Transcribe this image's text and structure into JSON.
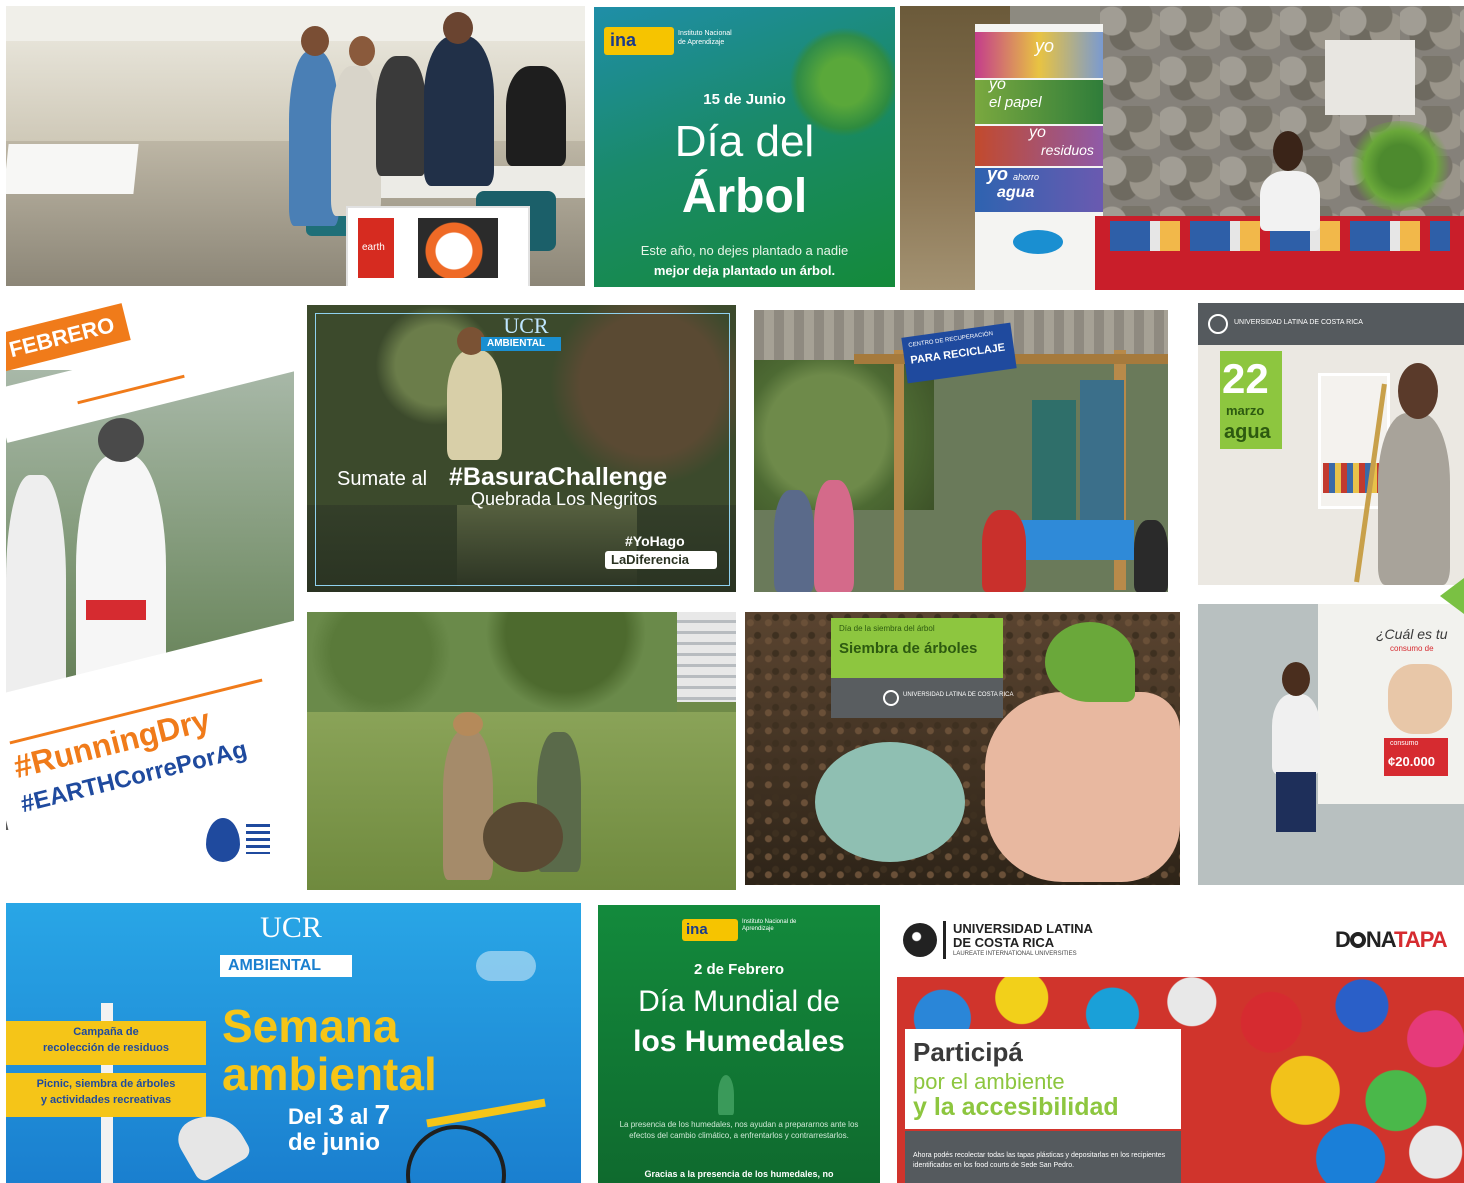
{
  "tiles": {
    "cafeteria": {
      "sign_brand": "earth"
    },
    "ina_arbol": {
      "logo": "ina",
      "logo_sub": "Instituto Nacional de Aprendizaje",
      "date": "15 de Junio",
      "title_line1": "Día del",
      "title_line2": "Árbol",
      "footer_line1": "Este año, no dejes plantado a nadie",
      "footer_line2": "mejor deja plantado un árbol."
    },
    "yo_banner": {
      "line1": "yo",
      "line2_prefix": "yo",
      "line2": "el papel",
      "line3_prefix": "yo",
      "line3": "residuos",
      "line4_prefix": "yo",
      "line4_small": "ahorro",
      "line4": "agua"
    },
    "running": {
      "month": "FEBRERO",
      "hashtag1": "#RunningDry",
      "hashtag2": "#EARTHCorrePorAg"
    },
    "basura": {
      "logo": "UCR",
      "logo_tag": "AMBIENTAL",
      "text_prefix": "Sumate al",
      "hashtag": "#BasuraChallenge",
      "subtitle": "Quebrada Los Negritos",
      "tag1": "#YoHago",
      "tag2": "LaDiferencia"
    },
    "reciclaje": {
      "sign": "PARA RECICLAJE",
      "sign_small": "CENTRO DE RECUPERACIÓN"
    },
    "agua": {
      "logo": "UNIVERSIDAD LATINA DE COSTA RICA",
      "day": "22",
      "month": "marzo",
      "word": "agua"
    },
    "siembra": {
      "small": "Día de la siembra del árbol",
      "title": "Siembra de árboles",
      "logo": "UNIVERSIDAD LATINA DE COSTA RICA"
    },
    "consumo": {
      "question": "¿Cuál es tu",
      "question2": "consumo de",
      "price_label": "consumo",
      "price": "¢20.000"
    },
    "semana": {
      "logo": "UCR",
      "logo_tag": "AMBIENTAL",
      "sign1_line1": "Campaña de",
      "sign1_line2": "recolección de residuos",
      "sign2_line1": "Picnic, siembra de árboles",
      "sign2_line2": "y actividades recreativas",
      "title1": "Semana",
      "title2": "ambiental",
      "dates_line1_a": "Del ",
      "dates_line1_b": "3",
      "dates_line1_c": " al ",
      "dates_line1_d": "7",
      "dates_line2": "de junio"
    },
    "humedales": {
      "logo": "ina",
      "logo_sub": "Instituto Nacional de Aprendizaje",
      "date": "2 de Febrero",
      "title_line1": "Día Mundial de",
      "title_line2": "los Humedales",
      "body": "La presencia de los humedales, nos ayudan a prepararnos ante los efectos del cambio climático, a enfrentarlos y contrarrestarlos.",
      "footer": "Gracias a la presencia de los humedales, no"
    },
    "donatapa": {
      "logo_line1": "UNIVERSIDAD LATINA",
      "logo_line2": "DE COSTA RICA",
      "logo_line3": "LAUREATE INTERNATIONAL UNIVERSITIES",
      "brand_a": "D",
      "brand_b": "NA",
      "brand_c": "TAPA",
      "heading1": "Participá",
      "heading2": "por el ambiente",
      "heading3": "y la accesibilidad",
      "body": "Ahora podés recolectar todas las tapas plásticas y depositarlas en los recipientes identificados en los food courts de Sede San Pedro."
    }
  },
  "colors": {
    "accent_green": "#7ac143",
    "ucr_blue": "#1a8fd1",
    "ina_green": "#1f8a3a",
    "ulatina_green": "#8dc63f",
    "orange": "#f07b1a"
  }
}
